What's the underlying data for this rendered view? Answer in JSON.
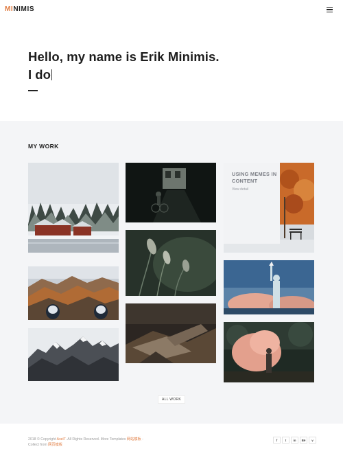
{
  "header": {
    "logo_accent": "MI",
    "logo_rest": "NIMIS",
    "menu_icon": "hamburger-icon"
  },
  "hero": {
    "title": "Hello, my name is Erik Minimis.",
    "subtitle": "I do"
  },
  "work": {
    "section_title": "MY WORK",
    "featured_card": {
      "heading": "USING MEMES IN CONTENT",
      "link": "View detail"
    },
    "all_work_button": "ALL WORK"
  },
  "footer": {
    "copyright_prefix": "2018 © Copyright",
    "company": "Axel7",
    "rights": ". All Rights Reserved. More Templates",
    "link_one": "网站模板",
    "separator": " - ",
    "collect_from": "Collect from",
    "link_two": "网页模板",
    "social": [
      {
        "name": "facebook-icon",
        "glyph": "f"
      },
      {
        "name": "twitter-icon",
        "glyph": "t"
      },
      {
        "name": "linkedin-icon",
        "glyph": "in"
      },
      {
        "name": "behance-icon",
        "glyph": "Bē"
      },
      {
        "name": "vimeo-icon",
        "glyph": "v"
      }
    ]
  },
  "colors": {
    "accent": "#e07a3f",
    "text": "#1d1d1d",
    "section_bg": "#f4f5f7"
  }
}
